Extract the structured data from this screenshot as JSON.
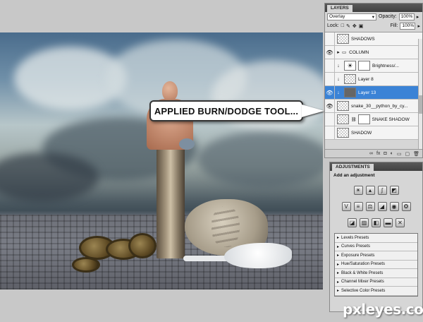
{
  "callout": {
    "text": "APPLIED BURN/DODGE TOOL..."
  },
  "layers_panel": {
    "tab": "LAYERS",
    "blend_mode": "Overlay",
    "opacity_label": "Opacity:",
    "opacity_value": "100%",
    "lock_label": "Lock:",
    "fill_label": "Fill:",
    "fill_value": "100%",
    "layers": [
      {
        "name": "SHADOWS",
        "type": "group-thumb"
      },
      {
        "name": "COLUMN",
        "type": "folder"
      },
      {
        "name": "Brightness/...",
        "type": "adjustment"
      },
      {
        "name": "Layer 8",
        "type": "layer"
      },
      {
        "name": "Layer 13",
        "type": "layer-selected"
      },
      {
        "name": "snake_30__python_by_cy...",
        "type": "layer"
      },
      {
        "name": "SNAKE SHADOW",
        "type": "layer-mask"
      },
      {
        "name": "SHADOW",
        "type": "layer"
      }
    ]
  },
  "adjustments_panel": {
    "tab": "ADJUSTMENTS",
    "title": "Add an adjustment",
    "presets": [
      "Levels Presets",
      "Curves Presets",
      "Exposure Presets",
      "Hue/Saturation Presets",
      "Black & White Presets",
      "Channel Mixer Presets",
      "Selective Color Presets"
    ]
  },
  "watermark": "pxleyes.com",
  "colors": {
    "selected_layer": "#3b83d6",
    "panel_bg": "#d6d6d6",
    "app_bg": "#c8c8c8"
  }
}
